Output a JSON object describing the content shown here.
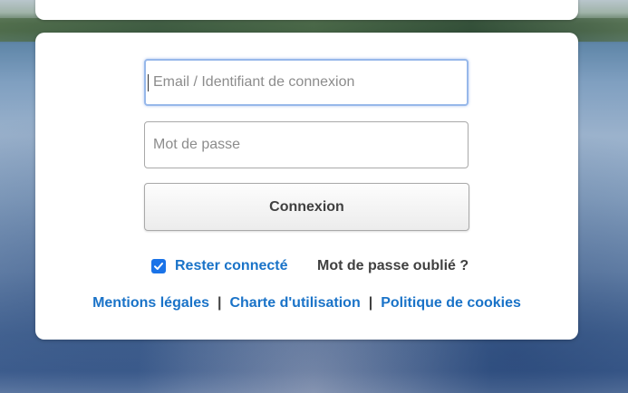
{
  "login": {
    "email_placeholder": "Email / Identifiant de connexion",
    "email_value": "",
    "password_placeholder": "Mot de passe",
    "password_value": "",
    "submit_label": "Connexion",
    "remember_label": "Rester connecté",
    "remember_checked": true,
    "forgot_label": "Mot de passe oublié ?"
  },
  "footer": {
    "links": [
      {
        "label": "Mentions légales"
      },
      {
        "label": "Charte d'utilisation"
      },
      {
        "label": "Politique de cookies"
      }
    ],
    "separator": "|"
  },
  "colors": {
    "accent": "#1a73c8",
    "checkbox": "#1a73e8",
    "focus_border": "#97b8ea",
    "text_dark": "#404040"
  },
  "icons": {
    "checkbox_checked": "checkmark-icon"
  }
}
